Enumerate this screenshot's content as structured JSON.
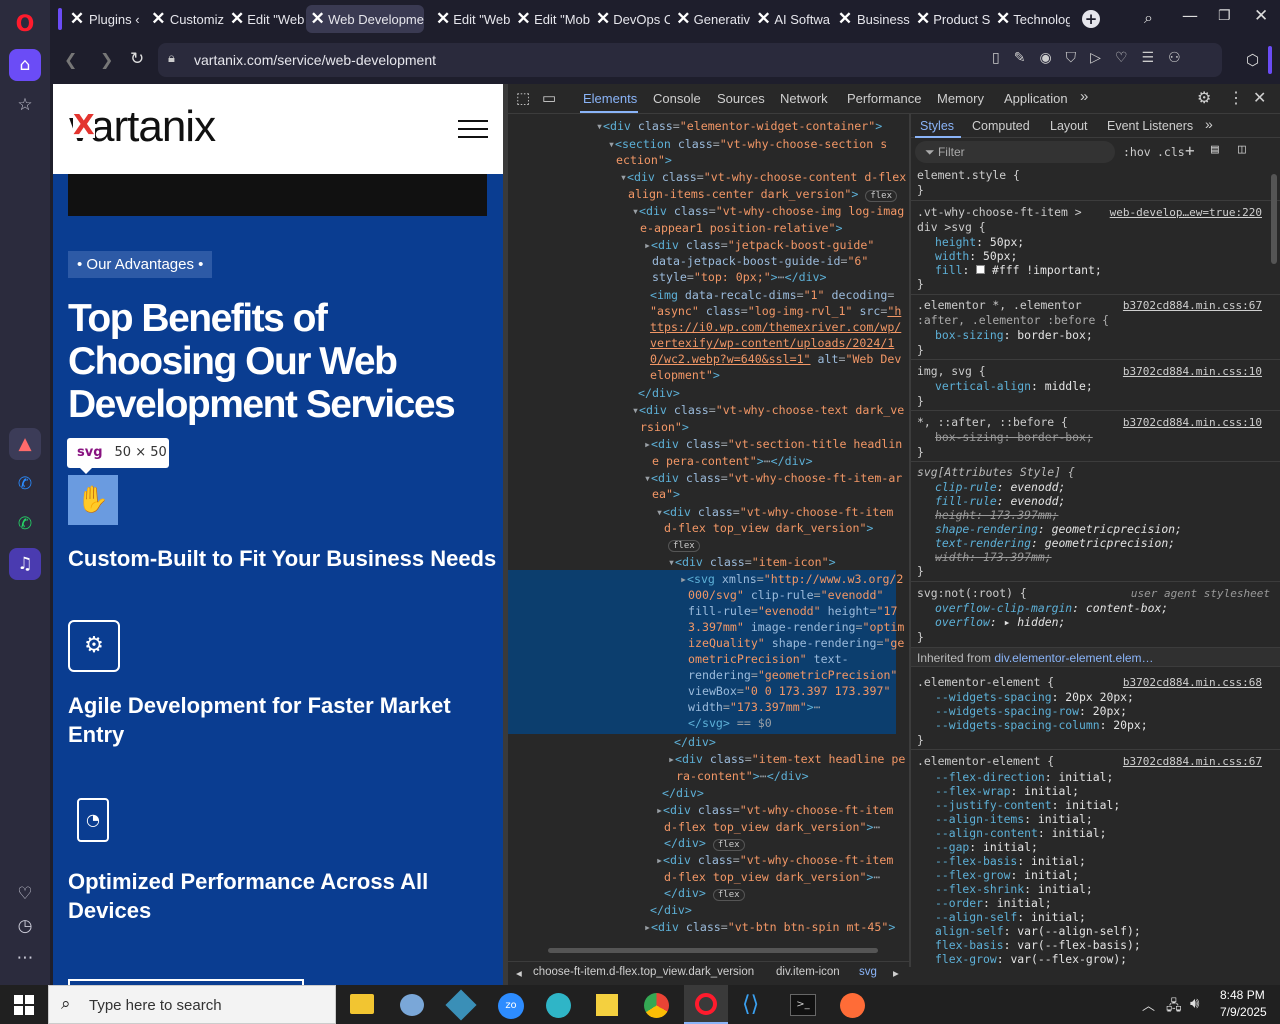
{
  "browser": {
    "tabs": [
      "Plugins ‹",
      "Customiz",
      "Edit \"Web",
      "Web Developme",
      "Edit \"Web",
      "Edit \"Mob",
      "DevOps C",
      "Generativ",
      "AI Softwa",
      "Business",
      "Product S",
      "Technolog"
    ],
    "url": "vartanix.com/service/web-development"
  },
  "site": {
    "logo": "vartanix",
    "badge": "• Our Advantages •",
    "heading": "Top Benefits of Choosing Our Web Development Services",
    "tooltip_tag": "svg",
    "tooltip_size": "50 × 50",
    "features": [
      "Custom-Built to Fit Your Business Needs",
      "Agile Development for Faster Market Entry",
      "Optimized Performance Across All Devices"
    ]
  },
  "devtools": {
    "tabs": [
      "Elements",
      "Console",
      "Sources",
      "Network",
      "Performance",
      "Memory",
      "Application"
    ],
    "style_tabs": [
      "Styles",
      "Computed",
      "Layout",
      "Event Listeners"
    ],
    "filter_placeholder": "Filter",
    "hov": ":hov",
    "cls": ".cls",
    "breadcrumb": [
      "choose-ft-item.d-flex.top_view.dark_version",
      "div.item-icon",
      "svg"
    ]
  },
  "taskbar": {
    "search_placeholder": "Type here to search",
    "time": "8:48 PM",
    "date": "7/9/2025"
  },
  "colors": {
    "page_bg": "#0a3d91",
    "opera_red": "#ff1b2d",
    "selection": "#0c3e6e"
  }
}
